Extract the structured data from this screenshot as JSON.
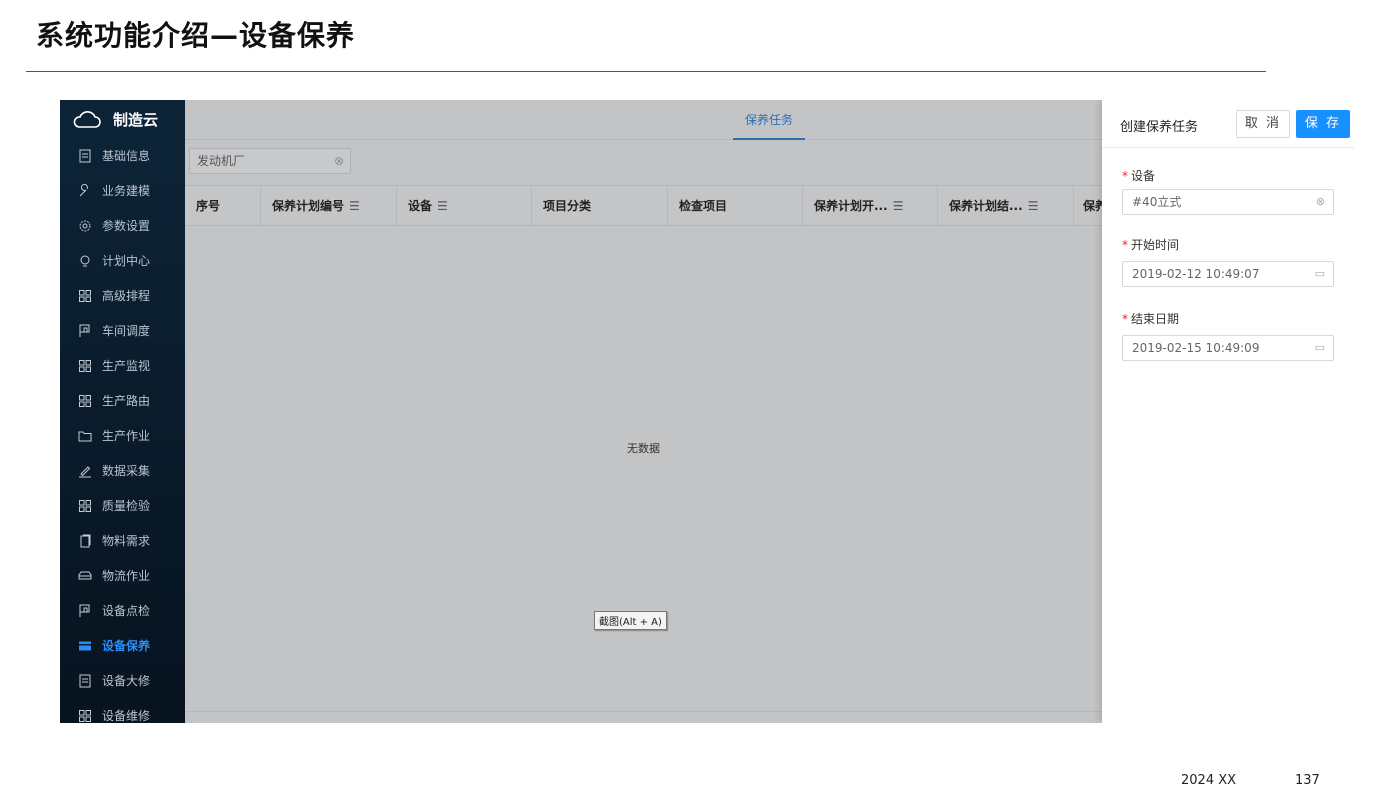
{
  "slide": {
    "title": "系统功能介绍—设备保养",
    "footer_date": "2024 XX",
    "page_number": "137"
  },
  "sidebar": {
    "brand": "制造云",
    "items": [
      {
        "label": "基础信息",
        "icon": "document-icon"
      },
      {
        "label": "业务建模",
        "icon": "wrench-icon"
      },
      {
        "label": "参数设置",
        "icon": "gear-icon"
      },
      {
        "label": "计划中心",
        "icon": "bulb-icon"
      },
      {
        "label": "高级排程",
        "icon": "grid-icon"
      },
      {
        "label": "车间调度",
        "icon": "flag-icon"
      },
      {
        "label": "生产监视",
        "icon": "grid-icon"
      },
      {
        "label": "生产路由",
        "icon": "grid-icon"
      },
      {
        "label": "生产作业",
        "icon": "folder-icon"
      },
      {
        "label": "数据采集",
        "icon": "pencil-icon"
      },
      {
        "label": "质量检验",
        "icon": "grid-icon"
      },
      {
        "label": "物料需求",
        "icon": "copy-icon"
      },
      {
        "label": "物流作业",
        "icon": "car-icon"
      },
      {
        "label": "设备点检",
        "icon": "flag-icon"
      },
      {
        "label": "设备保养",
        "icon": "card-icon",
        "active": true
      },
      {
        "label": "设备大修",
        "icon": "document-icon"
      },
      {
        "label": "设备维修",
        "icon": "grid-icon"
      }
    ]
  },
  "main": {
    "tab": "保养任务",
    "filter_value": "发动机厂",
    "columns": [
      "序号",
      "保养计划编号",
      "设备",
      "项目分类",
      "检查项目",
      "保养计划开...",
      "保养计划结...",
      "保养"
    ],
    "empty_text": "无数据",
    "tooltip": "截图(Alt + A)"
  },
  "drawer": {
    "title": "创建保养任务",
    "cancel_label": "取 消",
    "save_label": "保 存",
    "fields": [
      {
        "label": "设备",
        "value": "#40立式"
      },
      {
        "label": "开始时间",
        "value": "2019-02-12 10:49:07"
      },
      {
        "label": "结束日期",
        "value": "2019-02-15 10:49:09"
      }
    ]
  },
  "colors": {
    "sidebar_bg": "#0d2438",
    "active": "#2b8cf6",
    "primary_button": "#1890ff",
    "required_mark": "#f5222d"
  }
}
